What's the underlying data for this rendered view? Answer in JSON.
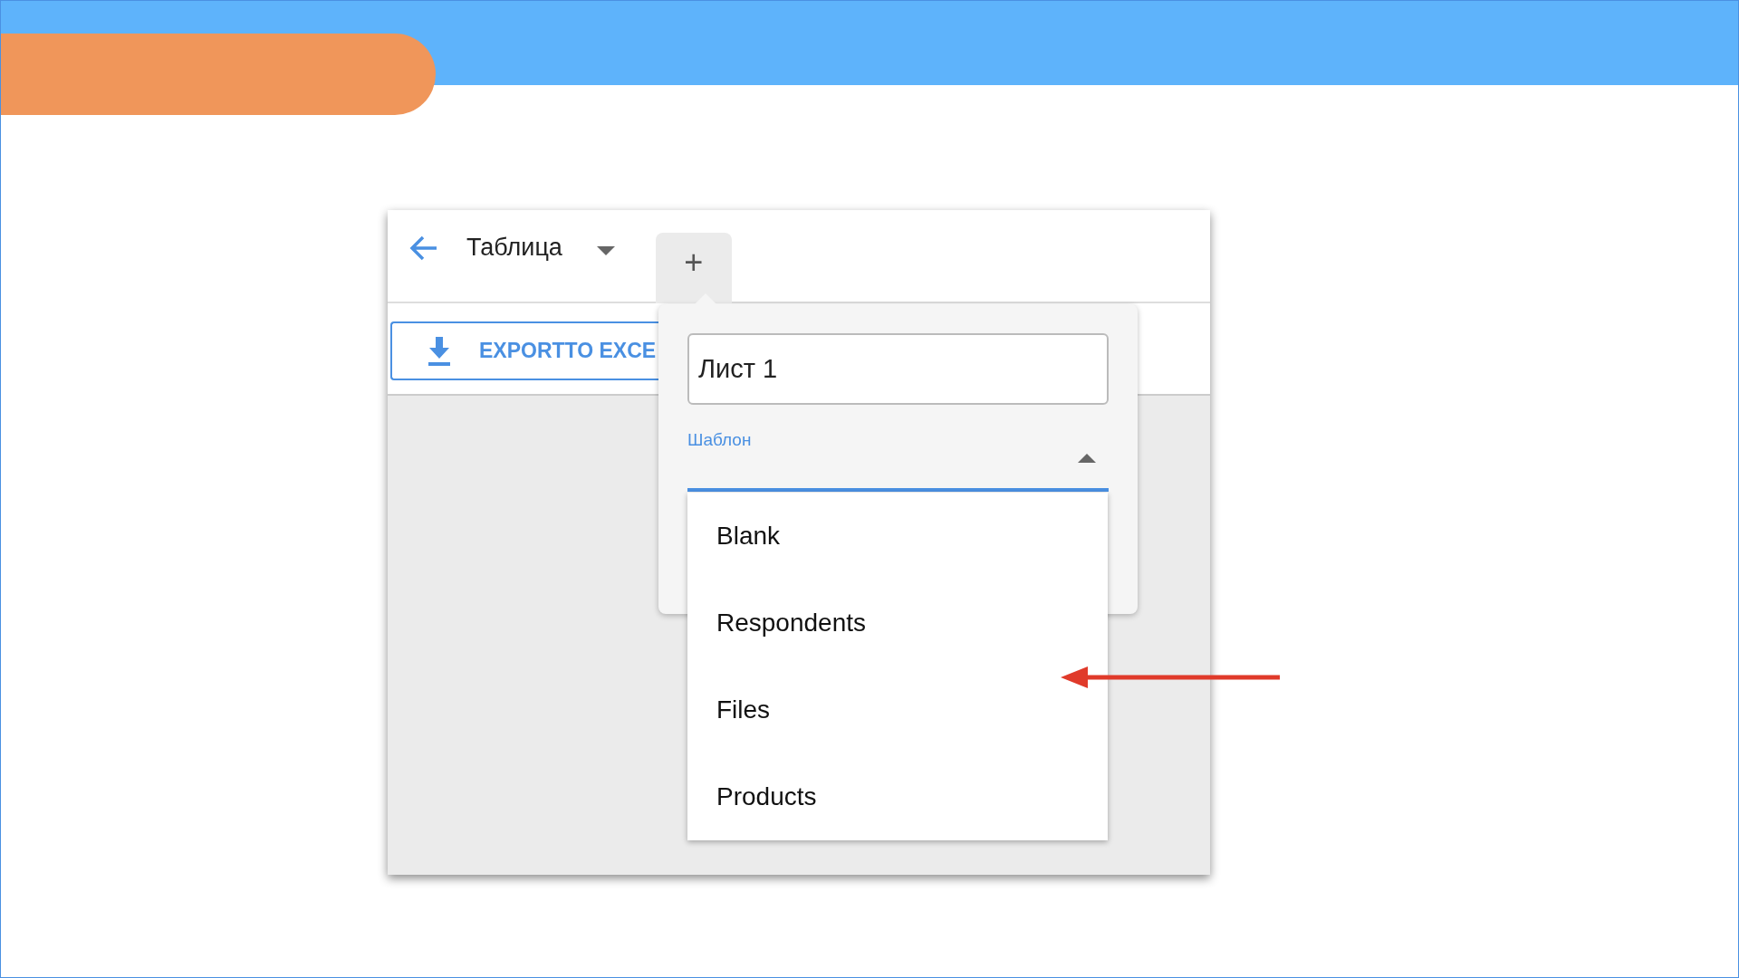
{
  "toolbar": {
    "title": "Таблица",
    "add_tab": "+"
  },
  "export_button": {
    "label": "EXPORTTO EXCE"
  },
  "new_sheet_popup": {
    "name_field": {
      "value": "Лист 1"
    },
    "template_select": {
      "label": "Шаблон",
      "expanded": true
    }
  },
  "template_options": [
    {
      "label": "Blank"
    },
    {
      "label": "Respondents"
    },
    {
      "label": "Files"
    },
    {
      "label": "Products"
    }
  ]
}
